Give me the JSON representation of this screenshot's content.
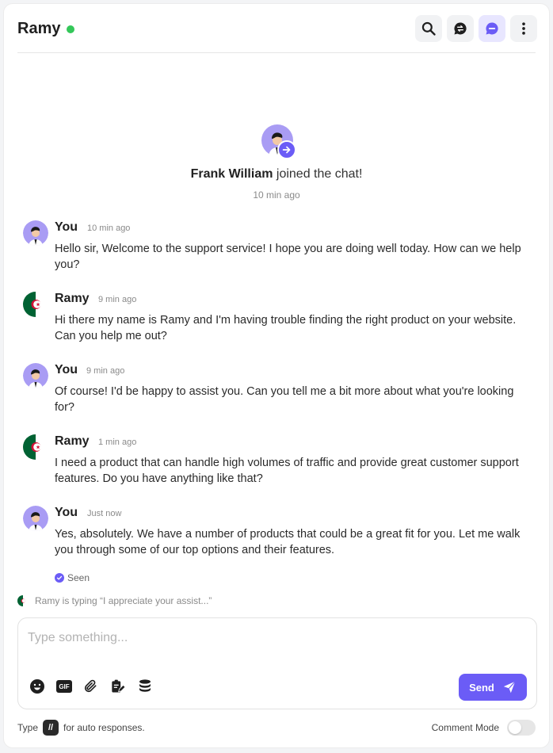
{
  "header": {
    "title": "Ramy",
    "status": "online",
    "status_color": "#34c759",
    "actions": [
      "search-icon",
      "chat-icon",
      "comment-icon",
      "more-icon"
    ]
  },
  "system": {
    "joined_name": "Frank William",
    "joined_suffix": " joined the chat!",
    "time": "10 min ago"
  },
  "messages": [
    {
      "sender": "You",
      "time": "10 min ago",
      "text": "Hello sir, Welcome to the support service! I hope you are doing well today. How can we help you?"
    },
    {
      "sender": "Ramy",
      "time": "9 min ago",
      "text": "Hi there my name is Ramy and I'm having trouble finding the right product on your website. Can you help me out?"
    },
    {
      "sender": "You",
      "time": "9 min ago",
      "text": "Of course! I'd be happy to assist you. Can you tell me a bit more about what you're looking for?"
    },
    {
      "sender": "Ramy",
      "time": "1 min ago",
      "text": "I need a product that can handle high volumes of traffic and provide great customer support features. Do you have anything like that?"
    },
    {
      "sender": "You",
      "time": "Just now",
      "text": "Yes, absolutely. We have a number of products that could be a great fit for you. Let me walk you through some of our top options and their features."
    }
  ],
  "seen_label": "Seen",
  "typing": "Ramy is typing “I appreciate your assist...”",
  "composer": {
    "placeholder": "Type something...",
    "tools": [
      "emoji-icon",
      "gif-icon",
      "attachment-icon",
      "notes-icon",
      "database-icon"
    ],
    "gif_label": "GIF",
    "send_label": "Send"
  },
  "footer": {
    "type_label": "Type",
    "shortcut": "//",
    "auto_label": "for auto responses.",
    "comment_mode_label": "Comment Mode",
    "comment_mode_on": false
  },
  "colors": {
    "accent": "#6b5cf6",
    "online": "#34c759"
  }
}
